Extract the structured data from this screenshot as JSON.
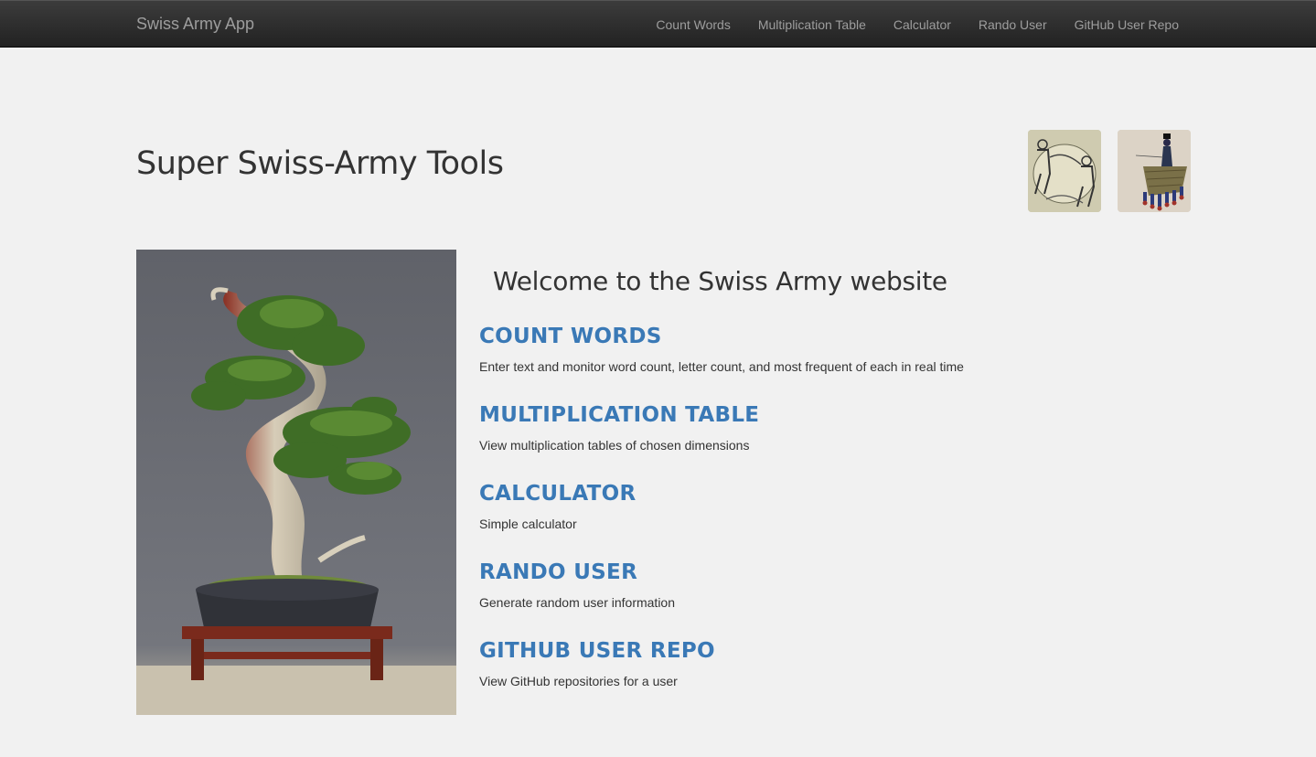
{
  "navbar": {
    "brand": "Swiss Army App",
    "links": [
      "Count Words",
      "Multiplication Table",
      "Calculator",
      "Rando User",
      "GitHub User Repo"
    ]
  },
  "page_title": "Super Swiss-Army Tools",
  "welcome": "Welcome to the Swiss Army website",
  "tools": [
    {
      "title": "Count Words",
      "description": "Enter text and monitor word count, letter count, and most frequent of each in real time"
    },
    {
      "title": "Multiplication Table",
      "description": "View multiplication tables of chosen dimensions"
    },
    {
      "title": "Calculator",
      "description": "Simple calculator"
    },
    {
      "title": "Rando User",
      "description": "Generate random user information"
    },
    {
      "title": "GitHub User Repo",
      "description": "View GitHub repositories for a user"
    }
  ],
  "colors": {
    "link_blue": "#3a79b6",
    "navbar": "#222222",
    "background": "#f1f1f1"
  }
}
